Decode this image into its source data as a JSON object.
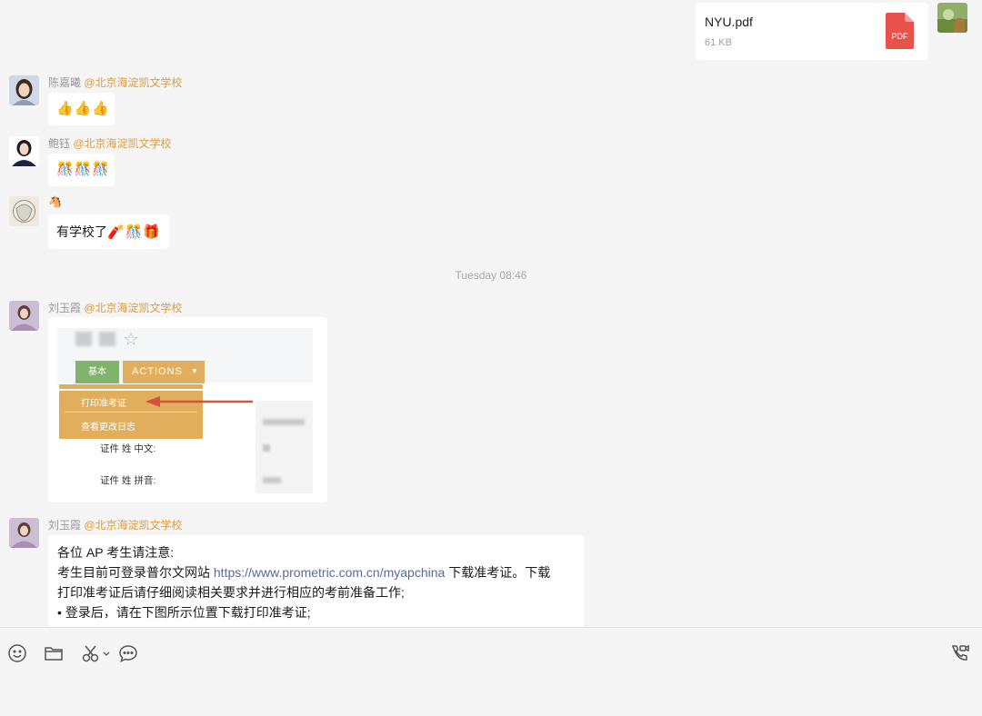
{
  "file_message": {
    "file_name": "NYU.pdf",
    "file_size": "61 KB",
    "file_type_label": "PDF"
  },
  "messages": [
    {
      "sender_name": "陈嘉曦",
      "sender_group": "@北京海淀凯文学校",
      "content_emojis": "👍👍👍"
    },
    {
      "sender_name": "鲍钰",
      "sender_group": "@北京海淀凯文学校",
      "content_emojis": "🎊🎊🎊"
    },
    {
      "sender_name": "🐴",
      "content_text": "有学校了",
      "content_emojis": "🧨🎊🎁"
    },
    {
      "sender_name": "刘玉霞",
      "sender_group": "@北京海淀凯文学校"
    },
    {
      "sender_name": "刘玉霞",
      "sender_group": "@北京海淀凯文学校"
    }
  ],
  "timestamp": "Tuesday 08:46",
  "screenshot": {
    "tab_basic": "基本",
    "actions_button": "ACTIONS",
    "menu_item_print": "打印准考证",
    "menu_item_log": "查看更改日志",
    "field_chinese_name": "证件 姓 中文:",
    "field_pinyin_name": "证件 姓 拼音:"
  },
  "text_message": {
    "line1": "各位 AP 考生请注意:",
    "line2_prefix": "考生目前可登录普尔文网站 ",
    "line2_url": "https://www.prometric.com.cn/myapchina",
    "line2_suffix": " 下载准考证。下载",
    "line3": "打印准考证后请仔细阅读相关要求并进行相应的考前准备工作;",
    "line4": "• 登录后，请在下图所示位置下载打印准考证;"
  },
  "toolbar": {
    "icons": [
      "emoji-icon",
      "folder-icon",
      "scissors-icon",
      "chevron-down-icon",
      "chat-bubble-icon",
      "video-call-icon"
    ]
  }
}
